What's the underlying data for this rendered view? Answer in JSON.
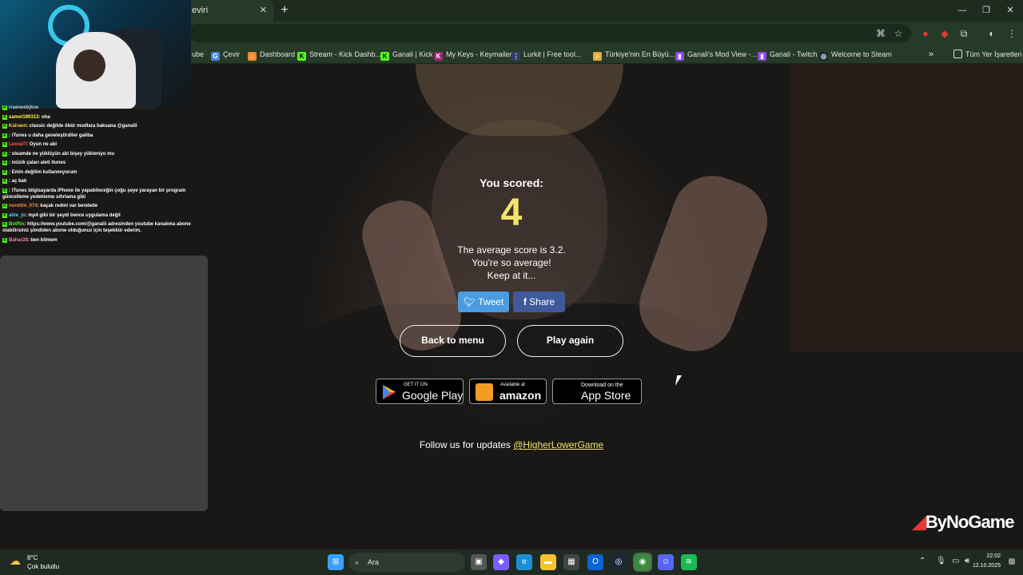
{
  "browser": {
    "tab_title": "eviri",
    "tab_close": "✕",
    "new_tab": "+",
    "bookmarks": [
      {
        "label": "ube",
        "icon_color": "#263a28"
      },
      {
        "label": "Çevir",
        "icon_color": "#4a86e8"
      },
      {
        "label": "Dashboard",
        "icon_color": "#ef8a2d"
      },
      {
        "label": "Stream - Kick Dashb...",
        "icon_color": "#53fc18"
      },
      {
        "label": "Ganali | Kick",
        "icon_color": "#53fc18"
      },
      {
        "label": "My Keys - Keymailer",
        "icon_color": "#9c2a72"
      },
      {
        "label": "Lurkit | Free tool...",
        "icon_color": "#2f3d66"
      },
      {
        "label": "Türkiye'nin En Büyü...",
        "icon_color": "#e6a93a"
      },
      {
        "label": "Ganali's Mod View -...",
        "icon_color": "#9146ff"
      },
      {
        "label": "Ganali - Twitch",
        "icon_color": "#9146ff"
      },
      {
        "label": "Welcome to Steam",
        "icon_color": "#1b2838"
      }
    ],
    "bookmarks_more": "»",
    "all_bookmarks": "Tüm Yer İşaretleri"
  },
  "game": {
    "scored_label": "You scored:",
    "score": "4",
    "avg_line1": "The average score is 3.2.",
    "avg_line2": "You're so average!",
    "avg_line3": "Keep at it...",
    "tweet_label": "Tweet",
    "share_label": "Share",
    "back_label": "Back to menu",
    "play_label": "Play again",
    "google_small": "GET IT ON",
    "google_big": "Google Play",
    "amazon_small": "Available at",
    "amazon_big": "amazon",
    "apple_small": "Download on the",
    "apple_big": "App Store",
    "follow_text": "Follow us for updates",
    "follow_link": "@HigherLowerGame",
    "score_color": "#f5e46a"
  },
  "overlay": {
    "brand_name": "ByNoGame",
    "chat": [
      {
        "user": "rraeneebjkne",
        "text": "",
        "color": "#c9c9c9"
      },
      {
        "user": "samet190313",
        "text": ": oha",
        "color": "#fff45c"
      },
      {
        "user": "Kalraen",
        "text": ": classic değilde öbür modlara baksana @ganalii",
        "color": "#ffd24d"
      },
      {
        "user": "",
        "text": ": iTunes u daha geneleştirdiler galiba",
        "color": "#ff5a5a"
      },
      {
        "user": "Lexxal7",
        "text": ": Oyun ne abi",
        "color": "#ff5a5a"
      },
      {
        "user": "",
        "text": ": steamde ne yüklüyün abi bişey yükleniyo mu",
        "color": "#6b8bff"
      },
      {
        "user": "",
        "text": ": müzik çaları aleti itunes",
        "color": "#ff5a5a"
      },
      {
        "user": "",
        "text": ": Emin değilim kullanmıyorum",
        "color": "#ff5a5a"
      },
      {
        "user": "",
        "text": ": aç bak",
        "color": "#ff5a5a"
      },
      {
        "user": "",
        "text": ": iTunes bilgisayarda iPhone ile yapabileceğin çoğu şeye yarayan bir program güncelleme yedekleme sıfırlama gibi",
        "color": "#6bc4ff"
      },
      {
        "user": "nurettin_074",
        "text": ": kaçak redmi var bendede",
        "color": "#ff8a4d"
      },
      {
        "user": "abie_jo",
        "text": ": mp4 gibi bir şeydi bence uygulama değil",
        "color": "#6bc4ff"
      },
      {
        "user": "BotRix",
        "text": ": https://www.youtube.com/@ganalii adresinden youtube kanalıma abone olabilirsiniz şimdiden abone olduğunuz için teşekkür ederim.",
        "color": "#53fc18"
      },
      {
        "user": "Bahar28",
        "text": ": ben bilmem",
        "color": "#ff7fb0"
      }
    ]
  },
  "taskbar": {
    "temp": "8°C",
    "weather": "Çok bulutlu",
    "search_placeholder": "Ara",
    "time": "22:02",
    "date": "12.10.2025"
  }
}
